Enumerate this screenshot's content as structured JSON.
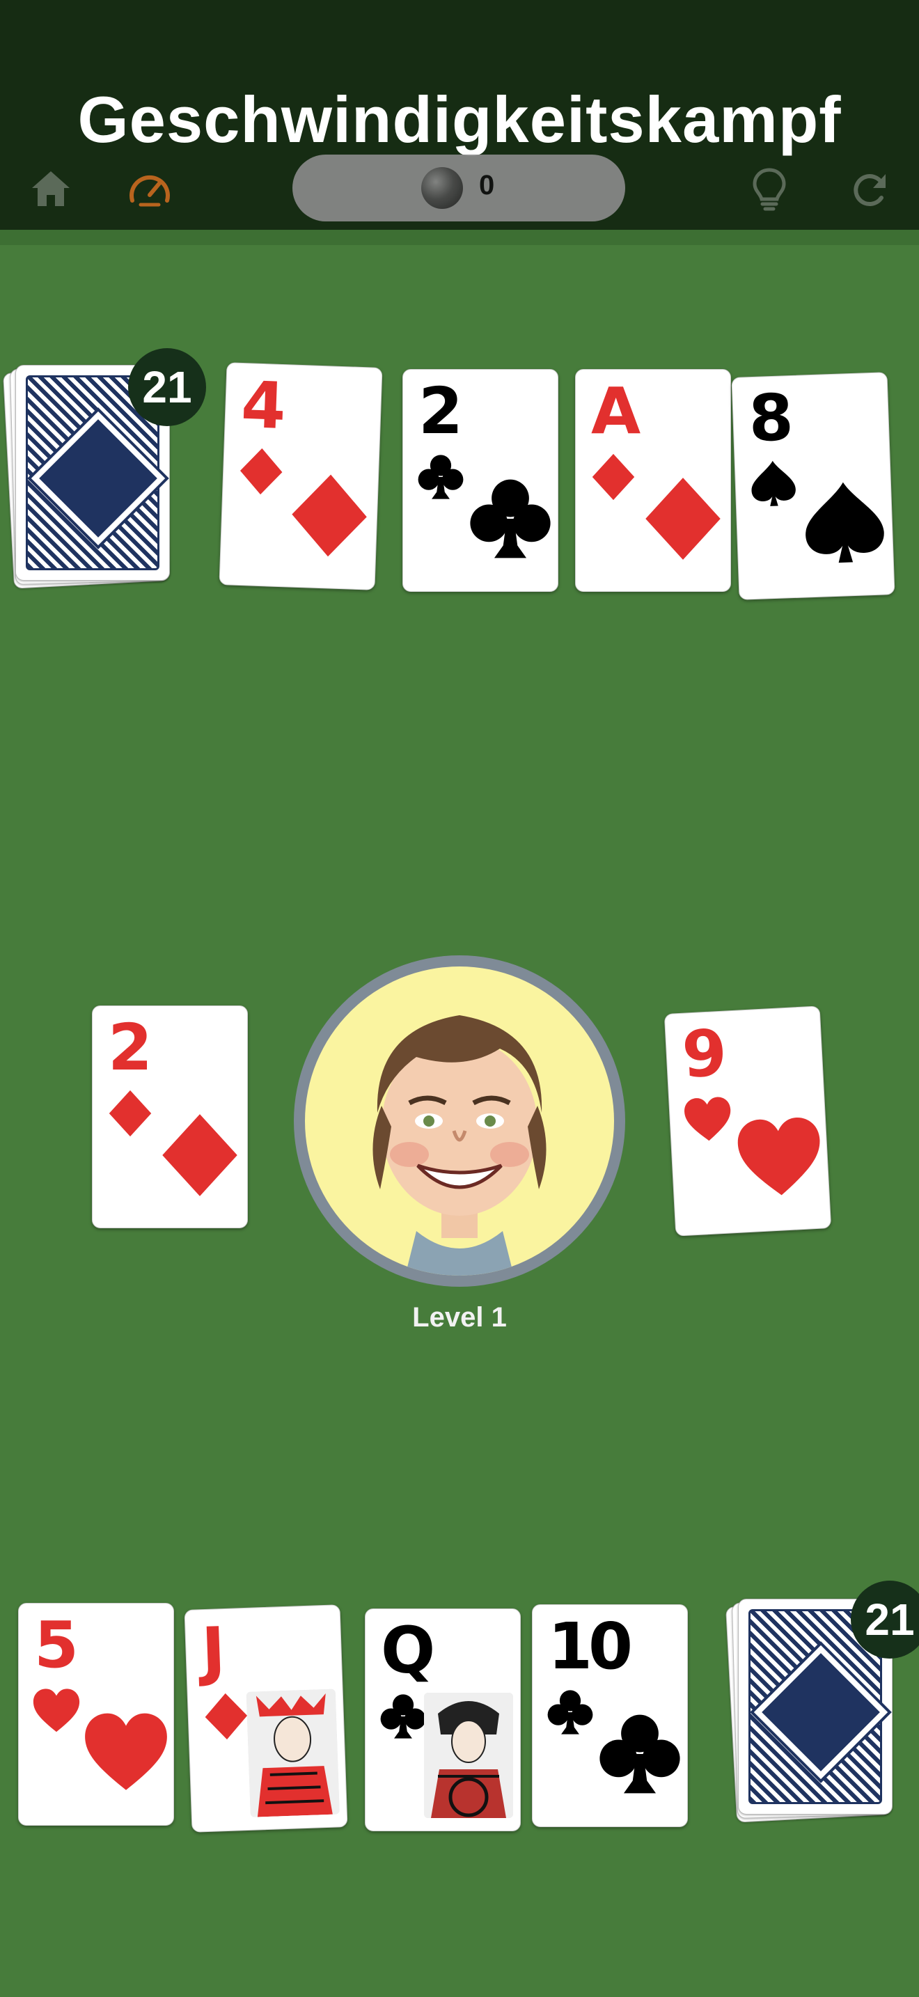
{
  "header": {
    "title": "Geschwindigkeitskampf",
    "coins": "0",
    "icons": [
      "home-icon",
      "speedometer-icon",
      "coin-icon",
      "lightbulb-icon",
      "restart-icon"
    ],
    "colors": {
      "bar": "#162c13",
      "table": "#477c3b",
      "speed_icon": "#b8641e",
      "inactive_icon": "#5b6a59"
    }
  },
  "opponent": {
    "deck_count": "21",
    "cards": [
      {
        "rank": "4",
        "suit": "diamonds"
      },
      {
        "rank": "2",
        "suit": "clubs"
      },
      {
        "rank": "A",
        "suit": "diamonds"
      },
      {
        "rank": "8",
        "suit": "spades"
      }
    ]
  },
  "center": {
    "left_pile": {
      "rank": "2",
      "suit": "diamonds"
    },
    "right_pile": {
      "rank": "9",
      "suit": "hearts"
    },
    "level": "Level 1"
  },
  "player": {
    "deck_count": "21",
    "cards": [
      {
        "rank": "5",
        "suit": "hearts"
      },
      {
        "rank": "J",
        "suit": "diamonds"
      },
      {
        "rank": "Q",
        "suit": "clubs"
      },
      {
        "rank": "10",
        "suit": "clubs"
      }
    ]
  }
}
